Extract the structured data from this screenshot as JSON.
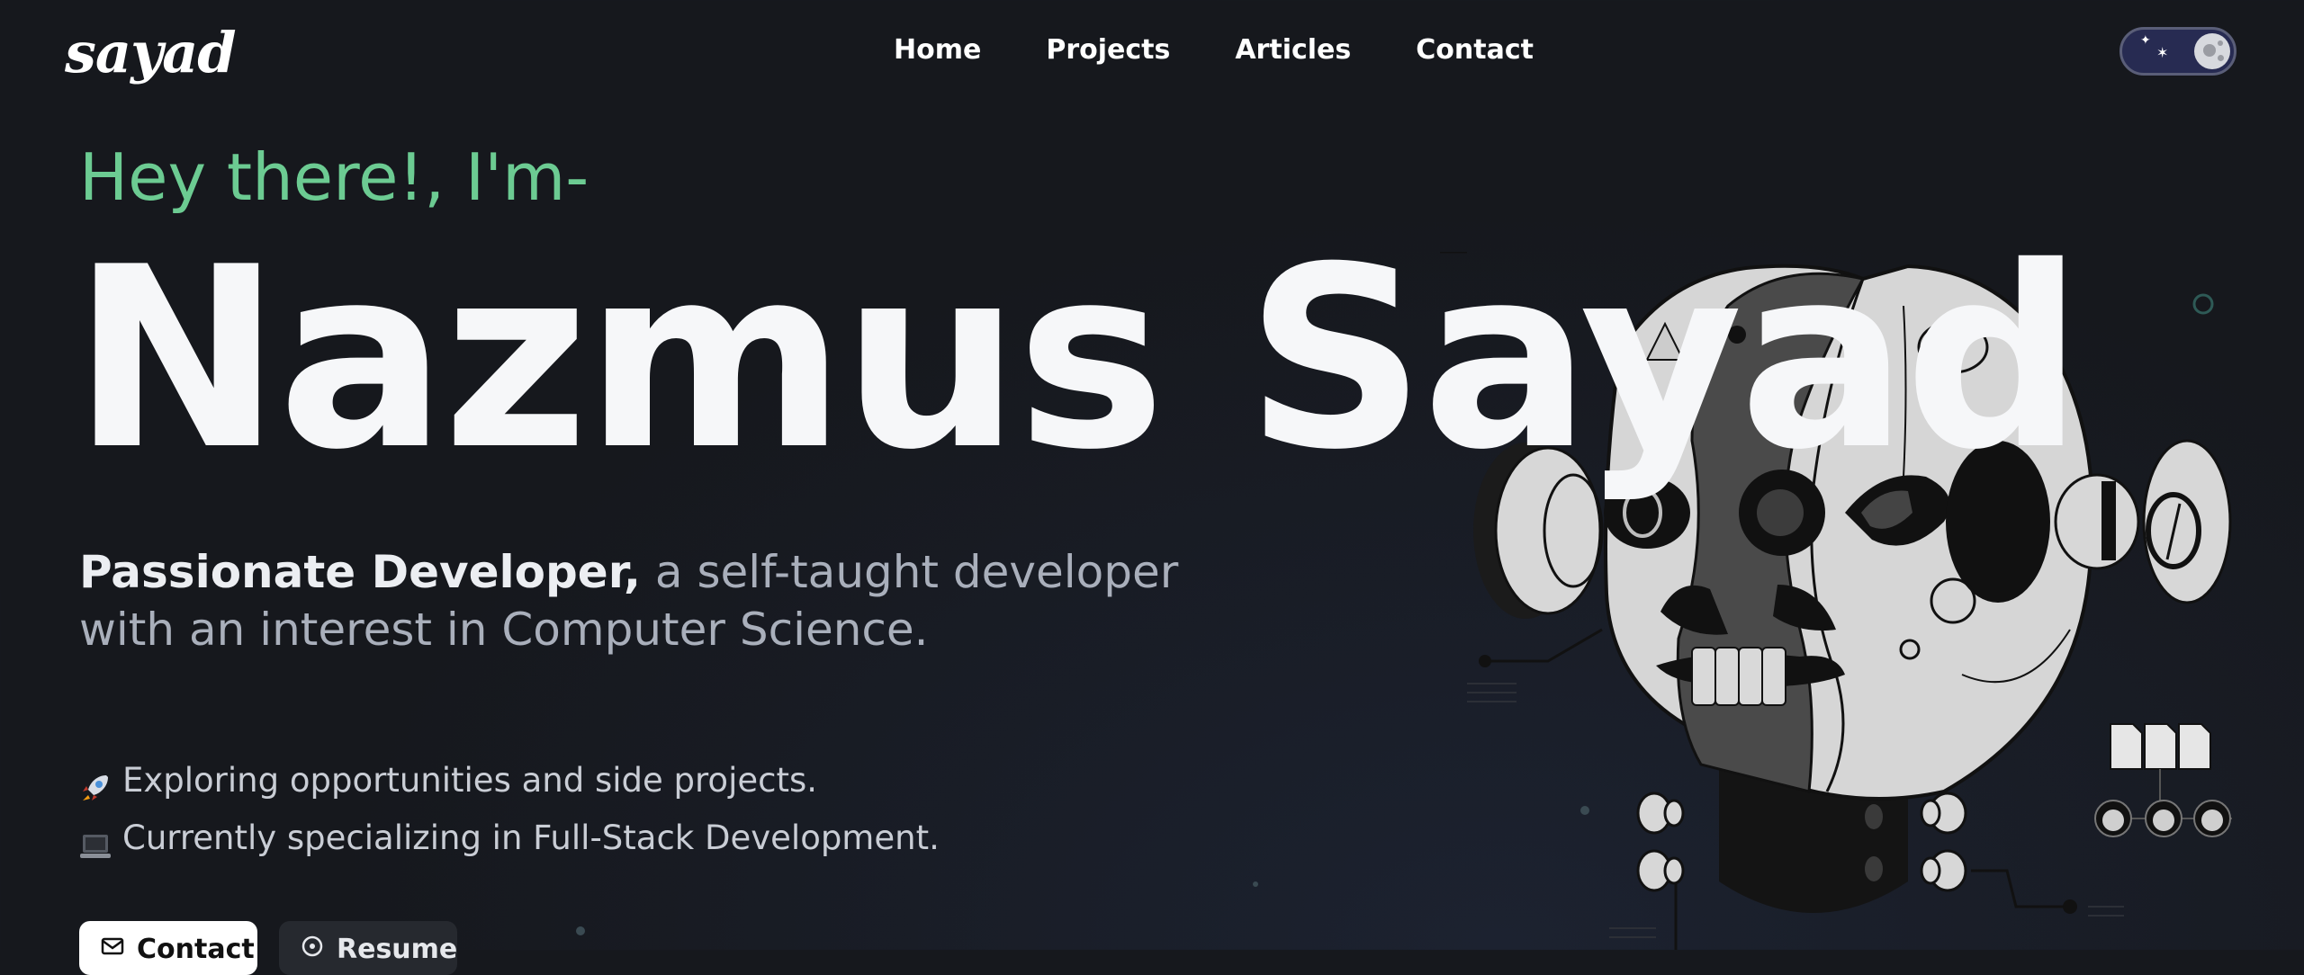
{
  "header": {
    "logo_text": "sayad",
    "nav": [
      "Home",
      "Projects",
      "Articles",
      "Contact"
    ],
    "theme_toggle": {
      "state": "dark"
    }
  },
  "hero": {
    "greeting": "Hey there!, I'm-",
    "name": "Nazmus Sayad",
    "tagline_bold": "Passionate Developer,",
    "tagline_rest": " a self-taught developer with an interest in Computer Science.",
    "bullets": [
      {
        "icon": "rocket-icon",
        "text": "Exploring opportunities and side projects."
      },
      {
        "icon": "laptop-icon",
        "text": "Currently specializing in Full-Stack Development."
      }
    ],
    "buttons": {
      "contact": "Contact",
      "resume": "Resume"
    }
  },
  "colors": {
    "accent_green": "#6ccb92",
    "background": "#16181d",
    "text": "#f6f7f9"
  }
}
